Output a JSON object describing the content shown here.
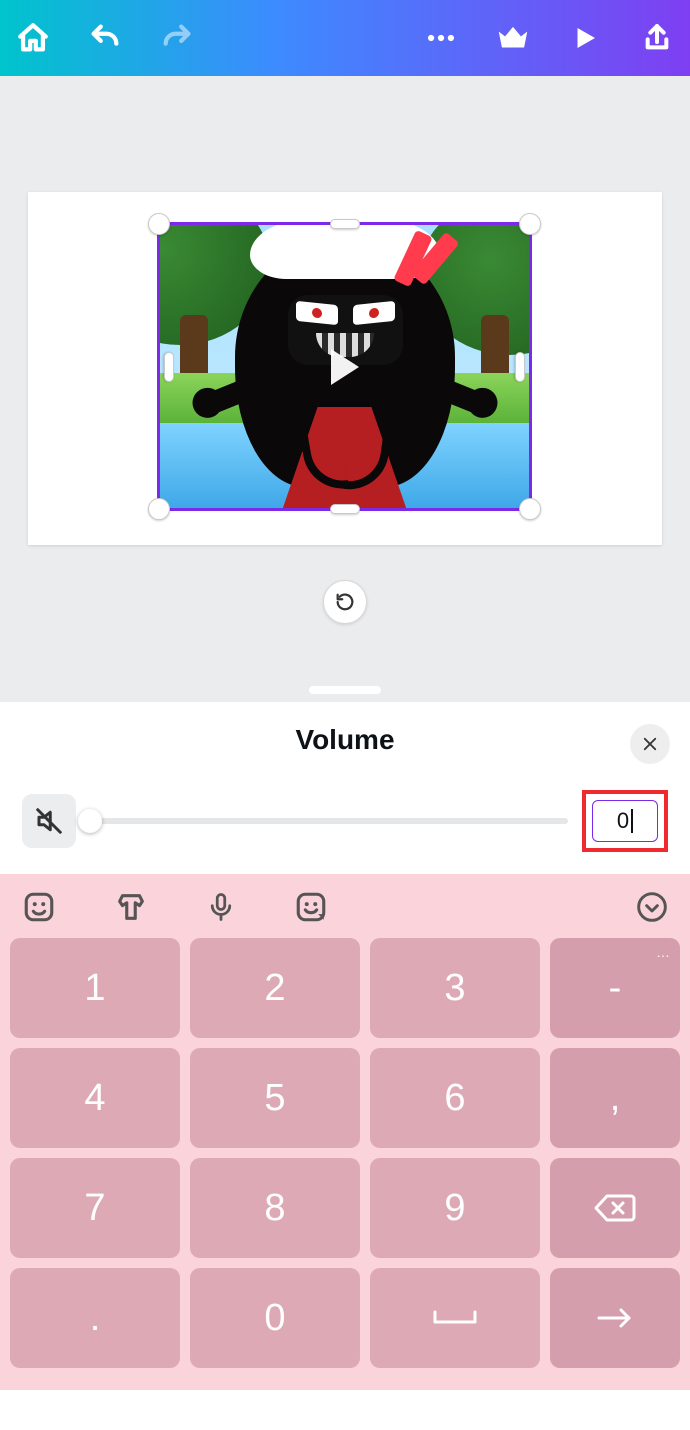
{
  "panel": {
    "title": "Volume"
  },
  "volume": {
    "value": "0"
  },
  "keypad": {
    "rows": [
      [
        "1",
        "2",
        "3"
      ],
      [
        "4",
        "5",
        "6"
      ],
      [
        "7",
        "8",
        "9"
      ],
      [
        ".",
        "0"
      ]
    ],
    "fn_dash_sup": "…",
    "fn_dash": "-",
    "fn_comma": ","
  }
}
